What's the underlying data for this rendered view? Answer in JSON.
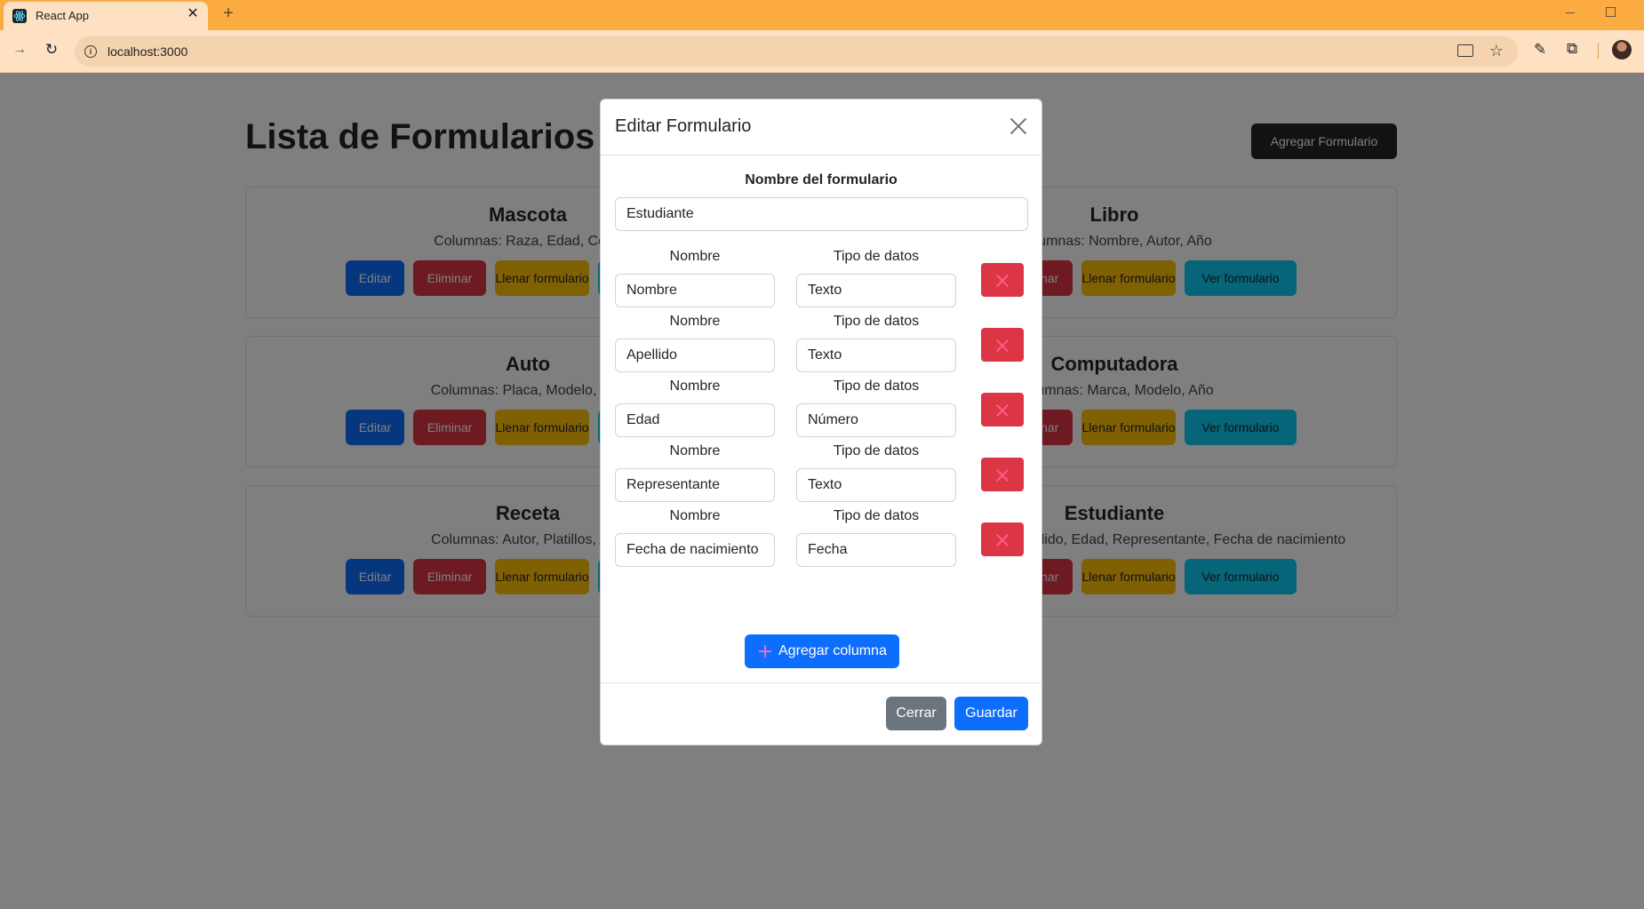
{
  "browser": {
    "tab_title": "React App",
    "new_tab_symbol": "+",
    "url": "localhost:3000"
  },
  "page": {
    "title": "Lista de Formularios",
    "add_form_label": "Agregar Formulario",
    "card_button_labels": {
      "edit": "Editar",
      "delete": "Eliminar",
      "fill": "Llenar formulario",
      "view": "Ver formulario"
    },
    "cards": [
      {
        "title": "Mascota",
        "columns": "Columnas: Raza, Edad, Color"
      },
      {
        "title": "Libro",
        "columns": "Columnas: Nombre, Autor, Año"
      },
      {
        "title": "Auto",
        "columns": "Columnas: Placa, Modelo, Año"
      },
      {
        "title": "Computadora",
        "columns": "Columnas: Marca, Modelo, Año"
      },
      {
        "title": "Receta",
        "columns": "Columnas: Autor, Platillos, Año"
      },
      {
        "title": "Estudiante",
        "columns": "Columnas: Nombre, Apellido, Edad, Representante, Fecha de nacimiento"
      }
    ]
  },
  "modal": {
    "title": "Editar Formulario",
    "form_name_label": "Nombre del formulario",
    "form_name_value": "Estudiante",
    "name_label": "Nombre",
    "type_label": "Tipo de datos",
    "columns": [
      {
        "name": "Nombre",
        "type": "Texto"
      },
      {
        "name": "Apellido",
        "type": "Texto"
      },
      {
        "name": "Edad",
        "type": "Número"
      },
      {
        "name": "Representante",
        "type": "Texto"
      },
      {
        "name": "Fecha de nacimiento",
        "type": "Fecha"
      }
    ],
    "add_column_label": "Agregar columna",
    "close_label": "Cerrar",
    "save_label": "Guardar"
  },
  "colors": {
    "browser_accent": "#fcab41",
    "primary": "#0d6efd",
    "danger": "#dc3545",
    "secondary": "#6c757d",
    "warning": "#ffc107",
    "info": "#0dcaf0"
  },
  "icons": [
    "react-favicon-icon",
    "tab-close-icon",
    "forward-icon",
    "reload-icon",
    "info-icon",
    "cast-icon",
    "star-icon",
    "pen-icon",
    "extensions-icon",
    "close-icon",
    "delete-x-icon",
    "plus-icon"
  ]
}
